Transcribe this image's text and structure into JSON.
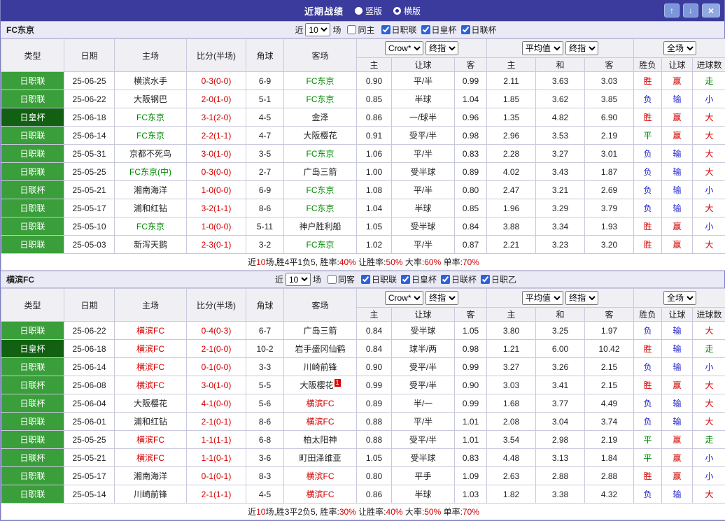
{
  "colors": {
    "titlebar_bg": "#3b3b9d",
    "type_green": "#3a9e3a",
    "type_dark_green": "#126112",
    "result_red": "#d40000",
    "result_blue": "#2222cc",
    "result_green": "#008a00",
    "section_header_bg": "#eaeaf6"
  },
  "titlebar": {
    "title": "近期战绩",
    "radios": [
      {
        "label": "竖版",
        "selected": false
      },
      {
        "label": "横版",
        "selected": true
      }
    ],
    "buttons": {
      "up": "↑",
      "down": "↓",
      "close": "×"
    }
  },
  "headers": {
    "type": "类型",
    "date": "日期",
    "home": "主场",
    "score": "比分(半场)",
    "corner": "角球",
    "away": "客场",
    "book_select": "Crow*",
    "book_index_select": "终指",
    "avg_select": "平均值",
    "avg_index_select": "终指",
    "scope_select": "全场",
    "odds_home": "主",
    "odds_handicap": "让球",
    "odds_away": "客",
    "avg_home": "主",
    "avg_draw": "和",
    "avg_away": "客",
    "result_wdl": "胜负",
    "result_handicap": "让球",
    "result_goals": "进球数"
  },
  "sections": [
    {
      "team": "FC东京",
      "controls": {
        "near_label": "近",
        "count_value": "10",
        "games_label": "场",
        "same_side": {
          "label": "同主",
          "checked": false
        },
        "leagues": [
          {
            "label": "日职联",
            "checked": true
          },
          {
            "label": "日皇杯",
            "checked": true
          },
          {
            "label": "日联杯",
            "checked": true
          }
        ]
      },
      "rows": [
        {
          "type": "日职联",
          "type_cls": "g",
          "date": "25-06-25",
          "home": "横滨水手",
          "home_cls": "",
          "score": "0-3(0-0)",
          "corner": "6-9",
          "away": "FC东京",
          "away_cls": "t-green",
          "o1": "0.90",
          "hcp": "平/半",
          "o2": "0.99",
          "a1": "2.11",
          "a2": "3.63",
          "a3": "3.03",
          "r1": "胜",
          "r1c": "t-red",
          "r2": "赢",
          "r2c": "t-red",
          "r3": "走",
          "r3c": "t-green"
        },
        {
          "type": "日职联",
          "type_cls": "g",
          "date": "25-06-22",
          "home": "大阪钢巴",
          "home_cls": "",
          "score": "2-0(1-0)",
          "corner": "5-1",
          "away": "FC东京",
          "away_cls": "t-green",
          "o1": "0.85",
          "hcp": "半球",
          "o2": "1.04",
          "a1": "1.85",
          "a2": "3.62",
          "a3": "3.85",
          "r1": "负",
          "r1c": "t-blue",
          "r2": "输",
          "r2c": "t-blue",
          "r3": "小",
          "r3c": "t-blue"
        },
        {
          "type": "日皇杯",
          "type_cls": "d",
          "date": "25-06-18",
          "home": "FC东京",
          "home_cls": "t-green",
          "score": "3-1(2-0)",
          "corner": "4-5",
          "away": "金泽",
          "away_cls": "",
          "o1": "0.86",
          "hcp": "一/球半",
          "o2": "0.96",
          "a1": "1.35",
          "a2": "4.82",
          "a3": "6.90",
          "r1": "胜",
          "r1c": "t-red",
          "r2": "赢",
          "r2c": "t-red",
          "r3": "大",
          "r3c": "t-red"
        },
        {
          "type": "日职联",
          "type_cls": "g",
          "date": "25-06-14",
          "home": "FC东京",
          "home_cls": "t-green",
          "score": "2-2(1-1)",
          "corner": "4-7",
          "away": "大阪樱花",
          "away_cls": "",
          "o1": "0.91",
          "hcp": "受平/半",
          "o2": "0.98",
          "a1": "2.96",
          "a2": "3.53",
          "a3": "2.19",
          "r1": "平",
          "r1c": "t-green",
          "r2": "赢",
          "r2c": "t-red",
          "r3": "大",
          "r3c": "t-red"
        },
        {
          "type": "日职联",
          "type_cls": "g",
          "date": "25-05-31",
          "home": "京都不死鸟",
          "home_cls": "",
          "score": "3-0(1-0)",
          "corner": "3-5",
          "away": "FC东京",
          "away_cls": "t-green",
          "o1": "1.06",
          "hcp": "平/半",
          "o2": "0.83",
          "a1": "2.28",
          "a2": "3.27",
          "a3": "3.01",
          "r1": "负",
          "r1c": "t-blue",
          "r2": "输",
          "r2c": "t-blue",
          "r3": "大",
          "r3c": "t-red"
        },
        {
          "type": "日职联",
          "type_cls": "g",
          "date": "25-05-25",
          "home": "FC东京(中)",
          "home_cls": "t-green",
          "score": "0-3(0-0)",
          "corner": "2-7",
          "away": "广岛三箭",
          "away_cls": "",
          "o1": "1.00",
          "hcp": "受半球",
          "o2": "0.89",
          "a1": "4.02",
          "a2": "3.43",
          "a3": "1.87",
          "r1": "负",
          "r1c": "t-blue",
          "r2": "输",
          "r2c": "t-blue",
          "r3": "大",
          "r3c": "t-red"
        },
        {
          "type": "日联杯",
          "type_cls": "g",
          "date": "25-05-21",
          "home": "湘南海洋",
          "home_cls": "",
          "score": "1-0(0-0)",
          "corner": "6-9",
          "away": "FC东京",
          "away_cls": "t-green",
          "o1": "1.08",
          "hcp": "平/半",
          "o2": "0.80",
          "a1": "2.47",
          "a2": "3.21",
          "a3": "2.69",
          "r1": "负",
          "r1c": "t-blue",
          "r2": "输",
          "r2c": "t-blue",
          "r3": "小",
          "r3c": "t-blue"
        },
        {
          "type": "日职联",
          "type_cls": "g",
          "date": "25-05-17",
          "home": "浦和红钻",
          "home_cls": "",
          "score": "3-2(1-1)",
          "corner": "8-6",
          "away": "FC东京",
          "away_cls": "t-green",
          "o1": "1.04",
          "hcp": "半球",
          "o2": "0.85",
          "a1": "1.96",
          "a2": "3.29",
          "a3": "3.79",
          "r1": "负",
          "r1c": "t-blue",
          "r2": "输",
          "r2c": "t-blue",
          "r3": "大",
          "r3c": "t-red"
        },
        {
          "type": "日职联",
          "type_cls": "g",
          "date": "25-05-10",
          "home": "FC东京",
          "home_cls": "t-green",
          "score": "1-0(0-0)",
          "corner": "5-11",
          "away": "神户胜利船",
          "away_cls": "",
          "o1": "1.05",
          "hcp": "受半球",
          "o2": "0.84",
          "a1": "3.88",
          "a2": "3.34",
          "a3": "1.93",
          "r1": "胜",
          "r1c": "t-red",
          "r2": "赢",
          "r2c": "t-red",
          "r3": "小",
          "r3c": "t-blue"
        },
        {
          "type": "日职联",
          "type_cls": "g",
          "date": "25-05-03",
          "home": "新泻天鹅",
          "home_cls": "",
          "score": "2-3(0-1)",
          "corner": "3-2",
          "away": "FC东京",
          "away_cls": "t-green",
          "o1": "1.02",
          "hcp": "平/半",
          "o2": "0.87",
          "a1": "2.21",
          "a2": "3.23",
          "a3": "3.20",
          "r1": "胜",
          "r1c": "t-red",
          "r2": "赢",
          "r2c": "t-red",
          "r3": "大",
          "r3c": "t-red"
        }
      ],
      "summary": [
        {
          "text": "近",
          "color": "black"
        },
        {
          "text": "10",
          "color": "red"
        },
        {
          "text": "场,胜4平1负5, 胜率:",
          "color": "black"
        },
        {
          "text": "40%",
          "color": "red"
        },
        {
          "text": " 让胜率:",
          "color": "black"
        },
        {
          "text": "50%",
          "color": "red"
        },
        {
          "text": " 大率:",
          "color": "black"
        },
        {
          "text": "60%",
          "color": "red"
        },
        {
          "text": " 单率:",
          "color": "black"
        },
        {
          "text": "70%",
          "color": "red"
        }
      ]
    },
    {
      "team": "横滨FC",
      "controls": {
        "near_label": "近",
        "count_value": "10",
        "games_label": "场",
        "same_side": {
          "label": "同客",
          "checked": false
        },
        "leagues": [
          {
            "label": "日职联",
            "checked": true
          },
          {
            "label": "日皇杯",
            "checked": true
          },
          {
            "label": "日联杯",
            "checked": true
          },
          {
            "label": "日职乙",
            "checked": true
          }
        ]
      },
      "rows": [
        {
          "type": "日职联",
          "type_cls": "g",
          "date": "25-06-22",
          "home": "横滨FC",
          "home_cls": "t-red",
          "score": "0-4(0-3)",
          "corner": "6-7",
          "away": "广岛三箭",
          "away_cls": "",
          "o1": "0.84",
          "hcp": "受半球",
          "o2": "1.05",
          "a1": "3.80",
          "a2": "3.25",
          "a3": "1.97",
          "r1": "负",
          "r1c": "t-blue",
          "r2": "输",
          "r2c": "t-blue",
          "r3": "大",
          "r3c": "t-red"
        },
        {
          "type": "日皇杯",
          "type_cls": "d",
          "date": "25-06-18",
          "home": "横滨FC",
          "home_cls": "t-red",
          "score": "2-1(0-0)",
          "corner": "10-2",
          "away": "岩手盛冈仙鹤",
          "away_cls": "",
          "o1": "0.84",
          "hcp": "球半/两",
          "o2": "0.98",
          "a1": "1.21",
          "a2": "6.00",
          "a3": "10.42",
          "r1": "胜",
          "r1c": "t-red",
          "r2": "输",
          "r2c": "t-blue",
          "r3": "走",
          "r3c": "t-green"
        },
        {
          "type": "日职联",
          "type_cls": "g",
          "date": "25-06-14",
          "home": "横滨FC",
          "home_cls": "t-red",
          "score": "0-1(0-0)",
          "corner": "3-3",
          "away": "川崎前锋",
          "away_cls": "",
          "o1": "0.90",
          "hcp": "受平/半",
          "o2": "0.99",
          "a1": "3.27",
          "a2": "3.26",
          "a3": "2.15",
          "r1": "负",
          "r1c": "t-blue",
          "r2": "输",
          "r2c": "t-blue",
          "r3": "小",
          "r3c": "t-blue"
        },
        {
          "type": "日联杯",
          "type_cls": "g",
          "date": "25-06-08",
          "home": "横滨FC",
          "home_cls": "t-red",
          "score": "3-0(1-0)",
          "corner": "5-5",
          "away": "大阪樱花",
          "away_cls": "",
          "badge": "1",
          "o1": "0.99",
          "hcp": "受平/半",
          "o2": "0.90",
          "a1": "3.03",
          "a2": "3.41",
          "a3": "2.15",
          "r1": "胜",
          "r1c": "t-red",
          "r2": "赢",
          "r2c": "t-red",
          "r3": "大",
          "r3c": "t-red"
        },
        {
          "type": "日联杯",
          "type_cls": "g",
          "date": "25-06-04",
          "home": "大阪樱花",
          "home_cls": "",
          "score": "4-1(0-0)",
          "corner": "5-6",
          "away": "横滨FC",
          "away_cls": "t-red",
          "o1": "0.89",
          "hcp": "半/一",
          "o2": "0.99",
          "a1": "1.68",
          "a2": "3.77",
          "a3": "4.49",
          "r1": "负",
          "r1c": "t-blue",
          "r2": "输",
          "r2c": "t-blue",
          "r3": "大",
          "r3c": "t-red"
        },
        {
          "type": "日职联",
          "type_cls": "g",
          "date": "25-06-01",
          "home": "浦和红钻",
          "home_cls": "",
          "score": "2-1(0-1)",
          "corner": "8-6",
          "away": "横滨FC",
          "away_cls": "t-red",
          "o1": "0.88",
          "hcp": "平/半",
          "o2": "1.01",
          "a1": "2.08",
          "a2": "3.04",
          "a3": "3.74",
          "r1": "负",
          "r1c": "t-blue",
          "r2": "输",
          "r2c": "t-blue",
          "r3": "大",
          "r3c": "t-red"
        },
        {
          "type": "日职联",
          "type_cls": "g",
          "date": "25-05-25",
          "home": "横滨FC",
          "home_cls": "t-red",
          "score": "1-1(1-1)",
          "corner": "6-8",
          "away": "柏太阳神",
          "away_cls": "",
          "o1": "0.88",
          "hcp": "受平/半",
          "o2": "1.01",
          "a1": "3.54",
          "a2": "2.98",
          "a3": "2.19",
          "r1": "平",
          "r1c": "t-green",
          "r2": "赢",
          "r2c": "t-red",
          "r3": "走",
          "r3c": "t-green"
        },
        {
          "type": "日联杯",
          "type_cls": "g",
          "date": "25-05-21",
          "home": "横滨FC",
          "home_cls": "t-red",
          "score": "1-1(0-1)",
          "corner": "3-6",
          "away": "町田泽维亚",
          "away_cls": "",
          "o1": "1.05",
          "hcp": "受半球",
          "o2": "0.83",
          "a1": "4.48",
          "a2": "3.13",
          "a3": "1.84",
          "r1": "平",
          "r1c": "t-green",
          "r2": "赢",
          "r2c": "t-red",
          "r3": "小",
          "r3c": "t-blue"
        },
        {
          "type": "日职联",
          "type_cls": "g",
          "date": "25-05-17",
          "home": "湘南海洋",
          "home_cls": "",
          "score": "0-1(0-1)",
          "corner": "8-3",
          "away": "横滨FC",
          "away_cls": "t-red",
          "o1": "0.80",
          "hcp": "平手",
          "o2": "1.09",
          "a1": "2.63",
          "a2": "2.88",
          "a3": "2.88",
          "r1": "胜",
          "r1c": "t-red",
          "r2": "赢",
          "r2c": "t-red",
          "r3": "小",
          "r3c": "t-blue"
        },
        {
          "type": "日职联",
          "type_cls": "g",
          "date": "25-05-14",
          "home": "川崎前锋",
          "home_cls": "",
          "score": "2-1(1-1)",
          "corner": "4-5",
          "away": "横滨FC",
          "away_cls": "t-red",
          "o1": "0.86",
          "hcp": "半球",
          "o2": "1.03",
          "a1": "1.82",
          "a2": "3.38",
          "a3": "4.32",
          "r1": "负",
          "r1c": "t-blue",
          "r2": "输",
          "r2c": "t-blue",
          "r3": "大",
          "r3c": "t-red"
        }
      ],
      "summary": [
        {
          "text": "近",
          "color": "black"
        },
        {
          "text": "10",
          "color": "red"
        },
        {
          "text": "场,胜3平2负5, 胜率:",
          "color": "black"
        },
        {
          "text": "30%",
          "color": "red"
        },
        {
          "text": " 让胜率:",
          "color": "black"
        },
        {
          "text": "40%",
          "color": "red"
        },
        {
          "text": " 大率:",
          "color": "black"
        },
        {
          "text": "50%",
          "color": "red"
        },
        {
          "text": " 单率:",
          "color": "black"
        },
        {
          "text": "70%",
          "color": "red"
        }
      ]
    }
  ]
}
